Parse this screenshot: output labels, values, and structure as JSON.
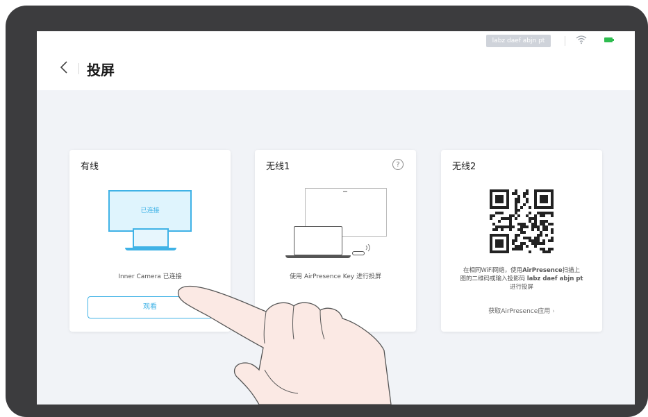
{
  "header": {
    "back_icon": "chevron-left-icon",
    "title": "投屏",
    "projection_code": "labz daef abjn pt",
    "wifi_icon": "wifi-icon",
    "battery_icon": "battery-icon",
    "battery_color": "#2ebc4f"
  },
  "cards": {
    "wired": {
      "title": "有线",
      "monitor_label": "已连接",
      "status": "Inner Camera 已连接",
      "button": "观看"
    },
    "wireless1": {
      "title": "无线1",
      "help_icon": "question-circle-icon",
      "help_glyph": "?",
      "description": "使用 AirPresence Key 进行投屏"
    },
    "wireless2": {
      "title": "无线2",
      "qr_icon": "qr-code-icon",
      "desc_line1_pre": "在相同WiFi网络，使用",
      "desc_line1_bold": "AirPresence",
      "desc_line1_post": "扫描上",
      "desc_line2_pre": "图的二维码或输入投影码 ",
      "desc_line2_bold": "labz daef abjn pt",
      "desc_line3": "进行投屏",
      "link": "获取AirPresence应用",
      "link_arrow": "›"
    }
  },
  "accent_color": "#3fb2e6"
}
